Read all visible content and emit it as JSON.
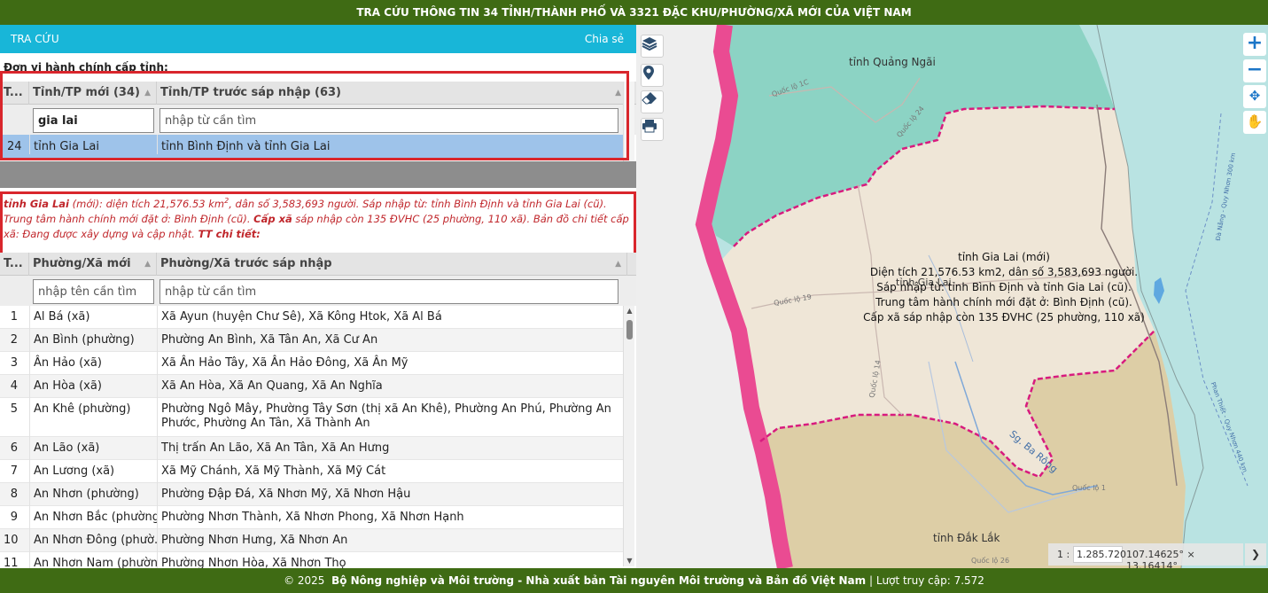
{
  "header": {
    "title": "TRA CỨU THÔNG TIN 34 TỈNH/THÀNH PHỐ VÀ 3321 ĐẶC KHU/PHƯỜNG/XÃ MỚI CỦA VIỆT NAM"
  },
  "toolbar": {
    "lookup_label": "TRA CỨU",
    "share_label": "Chia sẻ"
  },
  "province_section": {
    "label": "Đơn vị hành chính cấp tỉnh:",
    "columns": [
      "T...",
      "Tỉnh/TP mới (34)",
      "Tỉnh/TP trước sáp nhập (63)"
    ],
    "filter_new_value": "gia lai",
    "filter_old_placeholder": "nhập từ cần tìm",
    "rows": [
      {
        "no": "24",
        "new": "tỉnh Gia Lai",
        "old": "tỉnh Bình Định và tỉnh Gia Lai"
      }
    ]
  },
  "info": {
    "name": "tỉnh Gia Lai",
    "text1": " (mới): diện tích 21,576.53 km",
    "sup": "2",
    "text2": ", dân số 3,583,693 người. Sáp nhập từ: tỉnh Bình Định và tỉnh Gia Lai (cũ). Trung tâm hành chính mới đặt ở: Bình Định (cũ). ",
    "commune_label": "Cấp xã",
    "text3": " sáp nhập còn 135 ĐVHC (25 phường, 110 xã). ",
    "detail_map": "Bản đồ chi tiết cấp xã: Đang được xây dựng và cập nhật.",
    "detail_label": "TT chi tiết:"
  },
  "commune_section": {
    "columns": [
      "T...",
      "Phường/Xã mới",
      "Phường/Xã trước sáp nhập"
    ],
    "filter_new_placeholder": "nhập tên cần tìm",
    "filter_old_placeholder": "nhập từ cần tìm",
    "rows": [
      {
        "no": "1",
        "new": "Al Bá (xã)",
        "old": "Xã Ayun (huyện Chư Sê), Xã Kông Htok, Xã Al Bá"
      },
      {
        "no": "2",
        "new": "An Bình (phường)",
        "old": "Phường An Bình, Xã Tân An, Xã Cư An"
      },
      {
        "no": "3",
        "new": "Ân Hảo (xã)",
        "old": "Xã Ân Hảo Tây, Xã Ân Hảo Đông, Xã Ân Mỹ"
      },
      {
        "no": "4",
        "new": "An Hòa (xã)",
        "old": "Xã An Hòa, Xã An Quang, Xã An Nghĩa"
      },
      {
        "no": "5",
        "new": "An Khê (phường)",
        "old": "Phường Ngô Mây, Phường Tây Sơn (thị xã An Khê), Phường An Phú, Phường An Phước, Phường An Tân, Xã Thành An"
      },
      {
        "no": "6",
        "new": "An Lão (xã)",
        "old": "Thị trấn An Lão, Xã An Tân, Xã An Hưng"
      },
      {
        "no": "7",
        "new": "An Lương (xã)",
        "old": "Xã Mỹ Chánh, Xã Mỹ Thành, Xã Mỹ Cát"
      },
      {
        "no": "8",
        "new": "An Nhơn (phường)",
        "old": "Phường Đập Đá, Xã Nhơn Mỹ, Xã Nhơn Hậu"
      },
      {
        "no": "9",
        "new": "An Nhơn Bắc (phường)",
        "old": "Phường Nhơn Thành, Xã Nhơn Phong, Xã Nhơn Hạnh"
      },
      {
        "no": "10",
        "new": "An Nhơn Đông (phườ...",
        "old": "Phường Nhơn Hưng, Xã Nhơn An"
      },
      {
        "no": "11",
        "new": "An Nhơn Nam (phường)",
        "old": "Phường Nhơn Hòa, Xã Nhơn Thọ"
      }
    ]
  },
  "map": {
    "labels": {
      "quang_ngai": "tỉnh Quảng Ngãi",
      "dak_lak": "tỉnh Đắk Lắk",
      "gia_lai_small": "tỉnh Gia Lai",
      "river": "Sg. Ba Rông",
      "road1": "Quốc lộ 19",
      "road2": "Quốc lộ 14",
      "road3": "Quốc lộ 24",
      "road4": "Quốc lộ 1C",
      "road5": "Quốc lộ 26",
      "road6": "Quốc lộ 1",
      "sea1": "Đà Nẵng - Quy Nhơn 300 km",
      "sea2": "Phan Thiết - Quy Nhơn 440 km"
    },
    "popup": [
      "tỉnh Gia Lai (mới)",
      "Diện tích 21,576.53 km2, dân số 3,583,693 người.",
      "Sáp nhập từ: tỉnh Bình Định và tỉnh Gia Lai (cũ).",
      "Trung tâm hành chính mới đặt ở: Bình Định (cũ).",
      "Cấp xã sáp nhập còn 135 ĐVHC (25 phường, 110 xã)"
    ],
    "scale_prefix": "1 :",
    "scale_value": "1.285.720",
    "coords": "107.14625° × 13.16414°",
    "colors": {
      "province_border": "#ea4b92",
      "quang_ngai_fill": "#8cd3c4",
      "gia_lai_fill": "#efe6d7",
      "dak_lak_fill": "#ddcea6",
      "sea": "#b9e3e2"
    }
  },
  "footer": {
    "copyright": "© 2025",
    "org": "Bộ Nông nghiệp và Môi trường - Nhà xuất bản Tài nguyên Môi trường và Bản đồ Việt Nam",
    "visits": "| Lượt truy cập: 7.572"
  }
}
